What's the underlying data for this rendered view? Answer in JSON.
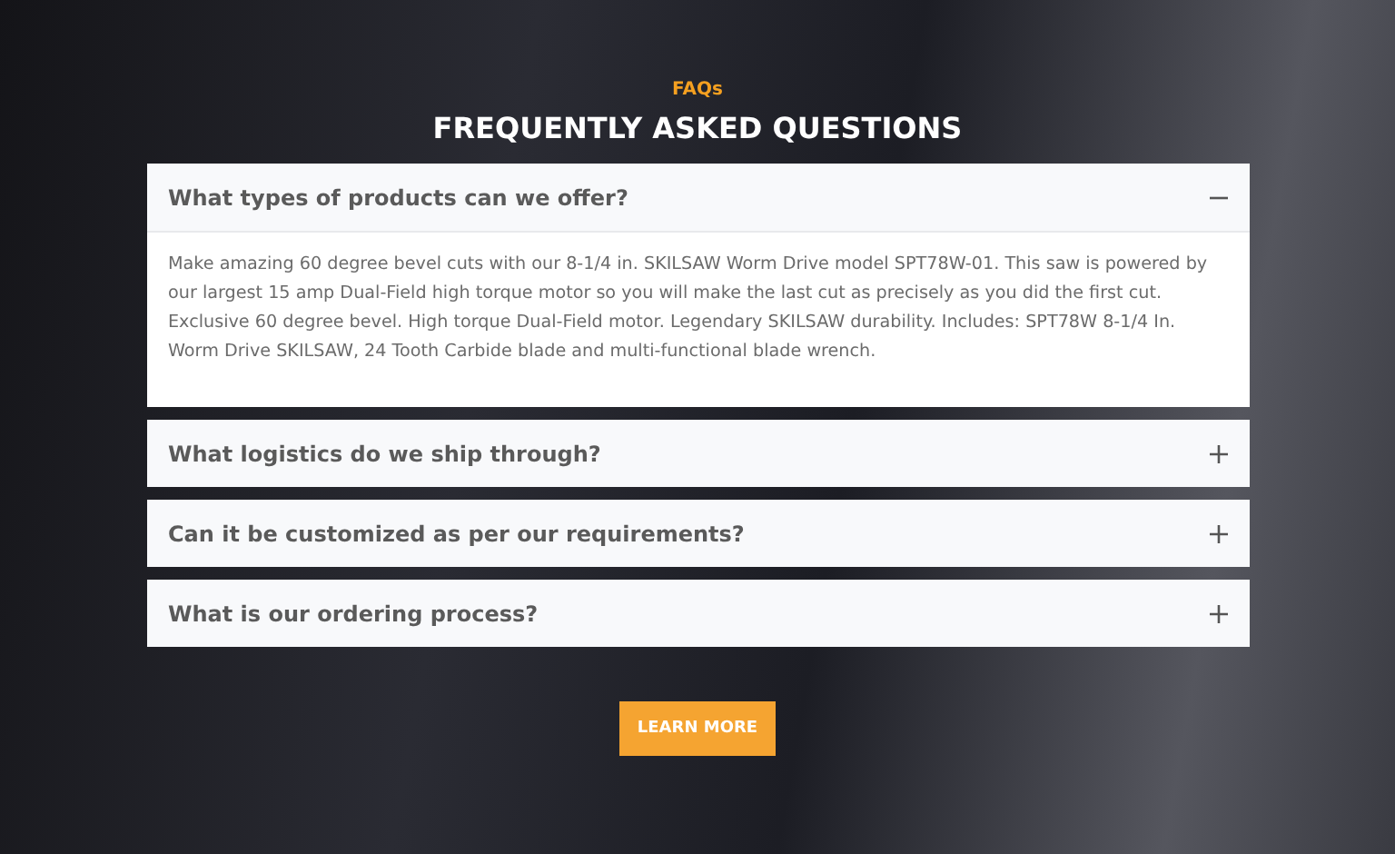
{
  "eyebrow": "FAQs",
  "title": "FREQUENTLY ASKED QUESTIONS",
  "faqs": [
    {
      "question": "What types of products can we offer?",
      "expanded": true,
      "answer": "Make amazing 60 degree bevel cuts with our 8-1/4 in. SKILSAW Worm Drive model SPT78W-01. This saw is powered by our largest 15 amp Dual-Field high torque motor so you will make the last cut as precisely as you did the first cut. Exclusive 60 degree bevel. High torque Dual-Field motor. Legendary SKILSAW durability. Includes: SPT78W 8-1/4 In. Worm Drive SKILSAW, 24 Tooth Carbide blade and multi-functional blade wrench."
    },
    {
      "question": "What logistics do we ship through?",
      "expanded": false
    },
    {
      "question": "Can it be customized as per our requirements?",
      "expanded": false
    },
    {
      "question": "What is our ordering process?",
      "expanded": false
    }
  ],
  "button": "LEARN MORE"
}
